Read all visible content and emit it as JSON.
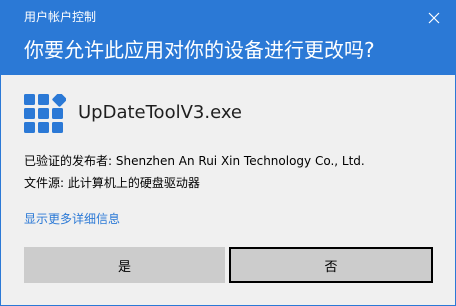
{
  "window": {
    "title": "用户帐户控制",
    "close_icon": "close-icon"
  },
  "prompt": {
    "question": "你要允许此应用对你的设备进行更改吗?"
  },
  "app": {
    "icon": "app-grid-icon",
    "name": "UpDateToolV3.exe"
  },
  "details": {
    "publisher_line": "已验证的发布者: Shenzhen An Rui Xin Technology Co., Ltd.",
    "origin_line": "文件源: 此计算机上的硬盘驱动器",
    "more_link": "显示更多详细信息"
  },
  "buttons": {
    "yes_label": "是",
    "no_label": "否"
  },
  "colors": {
    "header": "#2b79d6",
    "link": "#2b79d6",
    "dialog_bg": "#f0f0f0",
    "button_bg": "#cccccc"
  }
}
